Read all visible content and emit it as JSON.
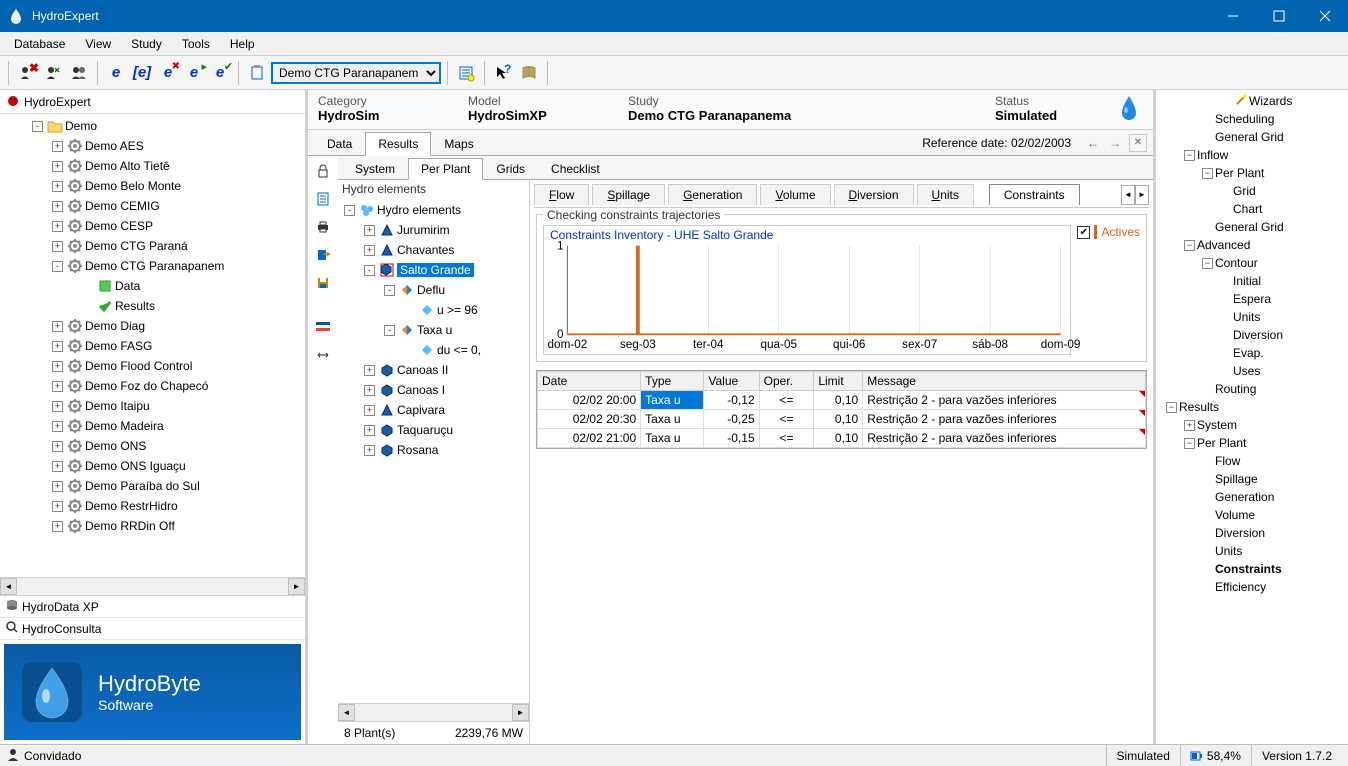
{
  "titlebar": {
    "title": "HydroExpert"
  },
  "menubar": [
    "Database",
    "View",
    "Study",
    "Tools",
    "Help"
  ],
  "toolbar": {
    "combo_value": "Demo CTG Paranapanem"
  },
  "left_panel": {
    "header": "HydroExpert",
    "root": "Demo",
    "items": [
      "Demo AES",
      "Demo Alto Tietê",
      "Demo Belo Monte",
      "Demo CEMIG",
      "Demo CESP",
      "Demo CTG Paraná"
    ],
    "expanded_item": "Demo CTG Paranapanem",
    "expanded_children": {
      "data": "Data",
      "results": "Results"
    },
    "items_after": [
      "Demo Diag",
      "Demo FASG",
      "Demo Flood Control",
      "Demo Foz do Chapecó",
      "Demo Itaipu",
      "Demo Madeira",
      "Demo ONS",
      "Demo ONS Iguaçu",
      "Demo Paraíba do Sul",
      "Demo RestrHidro",
      "Demo RRDin Off"
    ],
    "tab2": "HydroData XP",
    "tab3": "HydroConsulta",
    "logo_title": "HydroByte",
    "logo_sub": "Software"
  },
  "info_header": {
    "cat_label": "Category",
    "cat_val": "HydroSim",
    "model_label": "Model",
    "model_val": "HydroSimXP",
    "study_label": "Study",
    "study_val": "Demo CTG Paranapanema",
    "status_label": "Status",
    "status_val": "Simulated"
  },
  "main_tabs": {
    "data": "Data",
    "results": "Results",
    "maps": "Maps",
    "ref_date": "Reference date: 02/02/2003"
  },
  "sub_tabs": {
    "system": "System",
    "perplant": "Per Plant",
    "grids": "Grids",
    "checklist": "Checklist"
  },
  "plant_tree": {
    "header": "Hydro elements",
    "root": "Hydro elements",
    "plants": [
      "Jurumirim",
      "Chavantes"
    ],
    "selected": "Salto Grande",
    "sel_children": {
      "deflu": "Deflu",
      "deflu_child": "u >= 96",
      "taxa": "Taxa u",
      "taxa_child": "du <= 0,"
    },
    "plants_after": [
      "Canoas II",
      "Canoas I",
      "Capivara",
      "Taquaruçu",
      "Rosana"
    ],
    "footer_count": "8 Plant(s)",
    "footer_mw": "2239,76 MW"
  },
  "cat_tabs": {
    "flow": "Flow",
    "spillage": "Spillage",
    "generation": "Generation",
    "volume": "Volume",
    "diversion": "Diversion",
    "units": "Units",
    "constraints": "Constraints"
  },
  "group_title": "Checking constraints trajectories",
  "chart_title": "Constraints Inventory - UHE Salto Grande",
  "actives_label": "Actives",
  "chart_data": {
    "type": "bar",
    "categories": [
      "dom-02",
      "seg-03",
      "ter-04",
      "qua-05",
      "qui-06",
      "sex-07",
      "sáb-08",
      "dom-09"
    ],
    "values": [
      0,
      1,
      0,
      0,
      0,
      0,
      0,
      0
    ],
    "ylim": [
      0,
      1
    ],
    "y_ticks": [
      0,
      1
    ],
    "title": "Constraints Inventory - UHE Salto Grande",
    "xlabel": "",
    "ylabel": ""
  },
  "table": {
    "headers": [
      "Date",
      "Type",
      "Value",
      "Oper.",
      "Limit",
      "Message"
    ],
    "rows": [
      {
        "date": "02/02 20:00",
        "type": "Taxa u",
        "value": "-0,12",
        "oper": "<=",
        "limit": "0,10",
        "msg": "Restrição 2 - para vazões inferiores",
        "sel": true,
        "cut": true
      },
      {
        "date": "02/02 20:30",
        "type": "Taxa u",
        "value": "-0,25",
        "oper": "<=",
        "limit": "0,10",
        "msg": "Restrição 2 - para vazões inferiores",
        "sel": false,
        "cut": true
      },
      {
        "date": "02/02 21:00",
        "type": "Taxa u",
        "value": "-0,15",
        "oper": "<=",
        "limit": "0,10",
        "msg": "Restrição 2 - para vazões inferiores",
        "sel": false,
        "cut": true
      }
    ]
  },
  "right": {
    "items": [
      {
        "t": "Wizards",
        "d": 3,
        "p": "",
        "x": "",
        "i": "w"
      },
      {
        "t": "Scheduling",
        "d": 2,
        "p": "",
        "x": "",
        "i": ""
      },
      {
        "t": "General Grid",
        "d": 2,
        "p": "",
        "x": "",
        "i": ""
      },
      {
        "t": "Inflow",
        "d": 1,
        "p": "-",
        "x": "-",
        "i": ""
      },
      {
        "t": "Per Plant",
        "d": 2,
        "p": "-",
        "x": "-",
        "i": ""
      },
      {
        "t": "Grid",
        "d": 3,
        "p": "",
        "x": "",
        "i": ""
      },
      {
        "t": "Chart",
        "d": 3,
        "p": "",
        "x": "",
        "i": ""
      },
      {
        "t": "General Grid",
        "d": 2,
        "p": "",
        "x": "",
        "i": ""
      },
      {
        "t": "Advanced",
        "d": 1,
        "p": "-",
        "x": "-",
        "i": ""
      },
      {
        "t": "Contour",
        "d": 2,
        "p": "-",
        "x": "-",
        "i": ""
      },
      {
        "t": "Initial",
        "d": 3,
        "p": "",
        "x": "",
        "i": ""
      },
      {
        "t": "Espera",
        "d": 3,
        "p": "",
        "x": "",
        "i": ""
      },
      {
        "t": "Units",
        "d": 3,
        "p": "",
        "x": "",
        "i": ""
      },
      {
        "t": "Diversion",
        "d": 3,
        "p": "",
        "x": "",
        "i": ""
      },
      {
        "t": "Evap.",
        "d": 3,
        "p": "",
        "x": "",
        "i": ""
      },
      {
        "t": "Uses",
        "d": 3,
        "p": "",
        "x": "",
        "i": ""
      },
      {
        "t": "Routing",
        "d": 2,
        "p": "",
        "x": "",
        "i": ""
      },
      {
        "t": "Results",
        "d": 0,
        "p": "-",
        "x": "-",
        "i": ""
      },
      {
        "t": "System",
        "d": 1,
        "p": "+",
        "x": "+",
        "i": ""
      },
      {
        "t": "Per Plant",
        "d": 1,
        "p": "-",
        "x": "-",
        "i": ""
      },
      {
        "t": "Flow",
        "d": 2,
        "p": "",
        "x": "",
        "i": ""
      },
      {
        "t": "Spillage",
        "d": 2,
        "p": "",
        "x": "",
        "i": ""
      },
      {
        "t": "Generation",
        "d": 2,
        "p": "",
        "x": "",
        "i": ""
      },
      {
        "t": "Volume",
        "d": 2,
        "p": "",
        "x": "",
        "i": ""
      },
      {
        "t": "Diversion",
        "d": 2,
        "p": "",
        "x": "",
        "i": ""
      },
      {
        "t": "Units",
        "d": 2,
        "p": "",
        "x": "",
        "i": ""
      },
      {
        "t": "Constraints",
        "d": 2,
        "p": "",
        "x": "",
        "i": "",
        "b": true
      },
      {
        "t": "Efficiency",
        "d": 2,
        "p": "",
        "x": "",
        "i": ""
      }
    ]
  },
  "statusbar": {
    "user": "Convidado",
    "simulated": "Simulated",
    "percent": "58,4%",
    "version": "Version 1.7.2"
  }
}
